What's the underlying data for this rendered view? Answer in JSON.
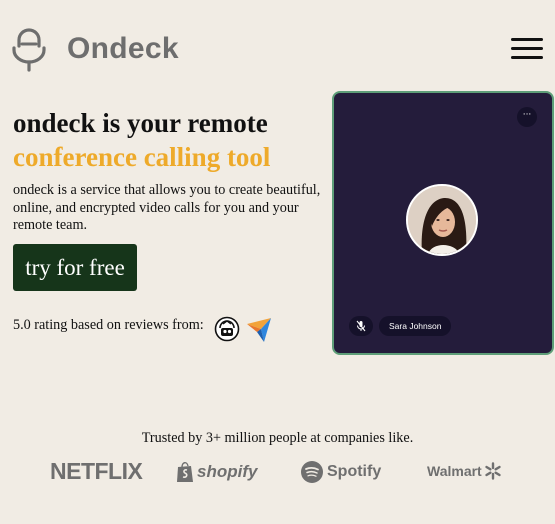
{
  "header": {
    "brand": "Ondeck",
    "logo_icon": "microphone-icon",
    "menu_icon": "hamburger-menu-icon"
  },
  "hero": {
    "title_line1": "ondeck is your remote",
    "title_line2": "conference calling tool",
    "description": "ondeck is a service that allows you to create beautiful, online, and encrypted video calls for you and your remote team.",
    "cta_label": "try for free",
    "rating_text": "5.0 rating based on reviews from:",
    "review_sources": [
      "review-site-badge-icon",
      "paper-plane-arrow-icon"
    ]
  },
  "call_card": {
    "participant_name": "Sara Johnson",
    "more_label": "···",
    "mic_icon": "microphone-muted-icon",
    "avatar": "participant-avatar"
  },
  "trusted": {
    "text": "Trusted by 3+ million people at companies like.",
    "companies": [
      "NETFLIX",
      "shopify",
      "Spotify",
      "Walmart"
    ]
  },
  "colors": {
    "background": "#f1ece4",
    "accent": "#eeaa2a",
    "cta_background": "#16351a",
    "card_background": "#241c3b",
    "card_border": "#5e9e78",
    "logo_gray": "#6e6e6e"
  }
}
